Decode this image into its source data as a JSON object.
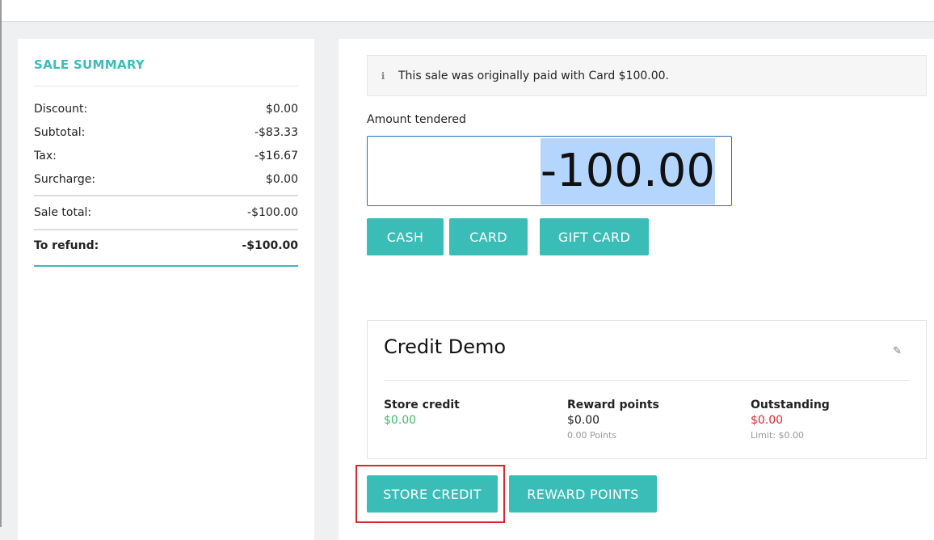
{
  "colors": {
    "accent": "#3bbdb7",
    "negative": "#e0282f",
    "positive": "#3bbd6f",
    "highlight": "#d8272d"
  },
  "summary": {
    "title": "SALE SUMMARY",
    "rows": [
      {
        "label": "Discount:",
        "value": "$0.00"
      },
      {
        "label": "Subtotal:",
        "value": "-$83.33"
      },
      {
        "label": "Tax:",
        "value": "-$16.67"
      },
      {
        "label": "Surcharge:",
        "value": "$0.00"
      }
    ],
    "sale_total": {
      "label": "Sale total:",
      "value": "-$100.00"
    },
    "to_refund": {
      "label": "To refund:",
      "value": "-$100.00"
    }
  },
  "main": {
    "info_message": "This sale was originally paid with Card $100.00.",
    "info_icon": "info-icon",
    "amount_label": "Amount tendered",
    "amount_value": "-100.00",
    "payment_buttons": [
      "CASH",
      "CARD",
      "GIFT CARD"
    ],
    "customer": {
      "name": "Credit Demo",
      "edit_icon": "pencil-icon",
      "store_credit": {
        "label": "Store credit",
        "value": "$0.00"
      },
      "reward_points": {
        "label": "Reward points",
        "value": "$0.00",
        "sub": "0.00 Points"
      },
      "outstanding": {
        "label": "Outstanding",
        "value": "$0.00",
        "sub": "Limit: $0.00"
      }
    },
    "action_buttons": [
      "STORE CREDIT",
      "REWARD POINTS"
    ]
  }
}
